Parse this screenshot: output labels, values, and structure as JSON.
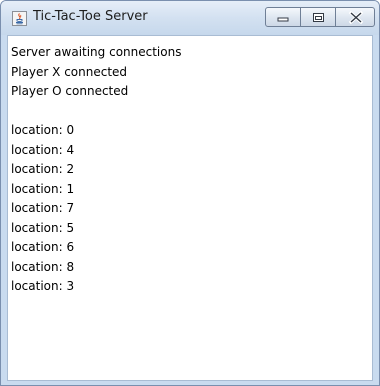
{
  "window": {
    "title": "Tic-Tac-Toe Server",
    "icon": "java-app-icon",
    "controls": [
      "minimize-icon",
      "maximize-icon",
      "close-icon"
    ]
  },
  "log": {
    "lines": [
      "Server awaiting connections",
      "Player X connected",
      "Player O connected",
      "",
      "location: 0",
      "location: 4",
      "location: 2",
      "location: 1",
      "location: 7",
      "location: 5",
      "location: 6",
      "location: 8",
      "location: 3"
    ]
  },
  "colors": {
    "frame": "#c9dbef",
    "text": "#000000",
    "background": "#ffffff"
  }
}
